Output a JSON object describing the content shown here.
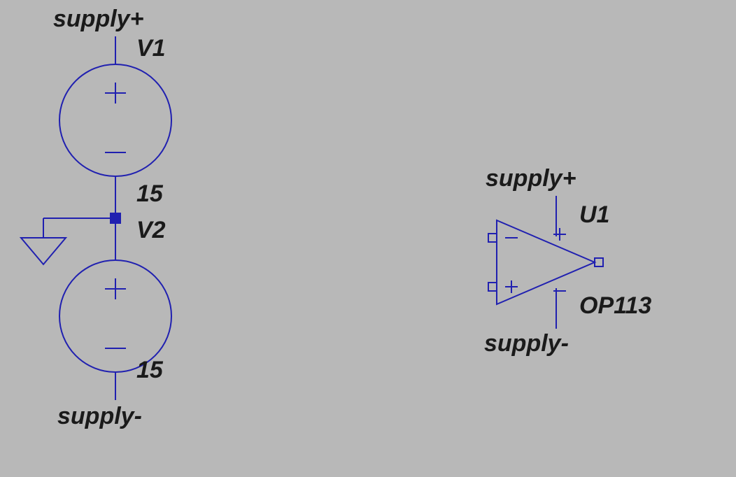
{
  "nets": {
    "supply_plus_left": "supply+",
    "supply_minus_left": "supply-",
    "supply_plus_right": "supply+",
    "supply_minus_right": "supply-"
  },
  "v1": {
    "ref": "V1",
    "value": "15"
  },
  "v2": {
    "ref": "V2",
    "value": "15"
  },
  "opamp": {
    "ref": "U1",
    "part": "OP113"
  }
}
